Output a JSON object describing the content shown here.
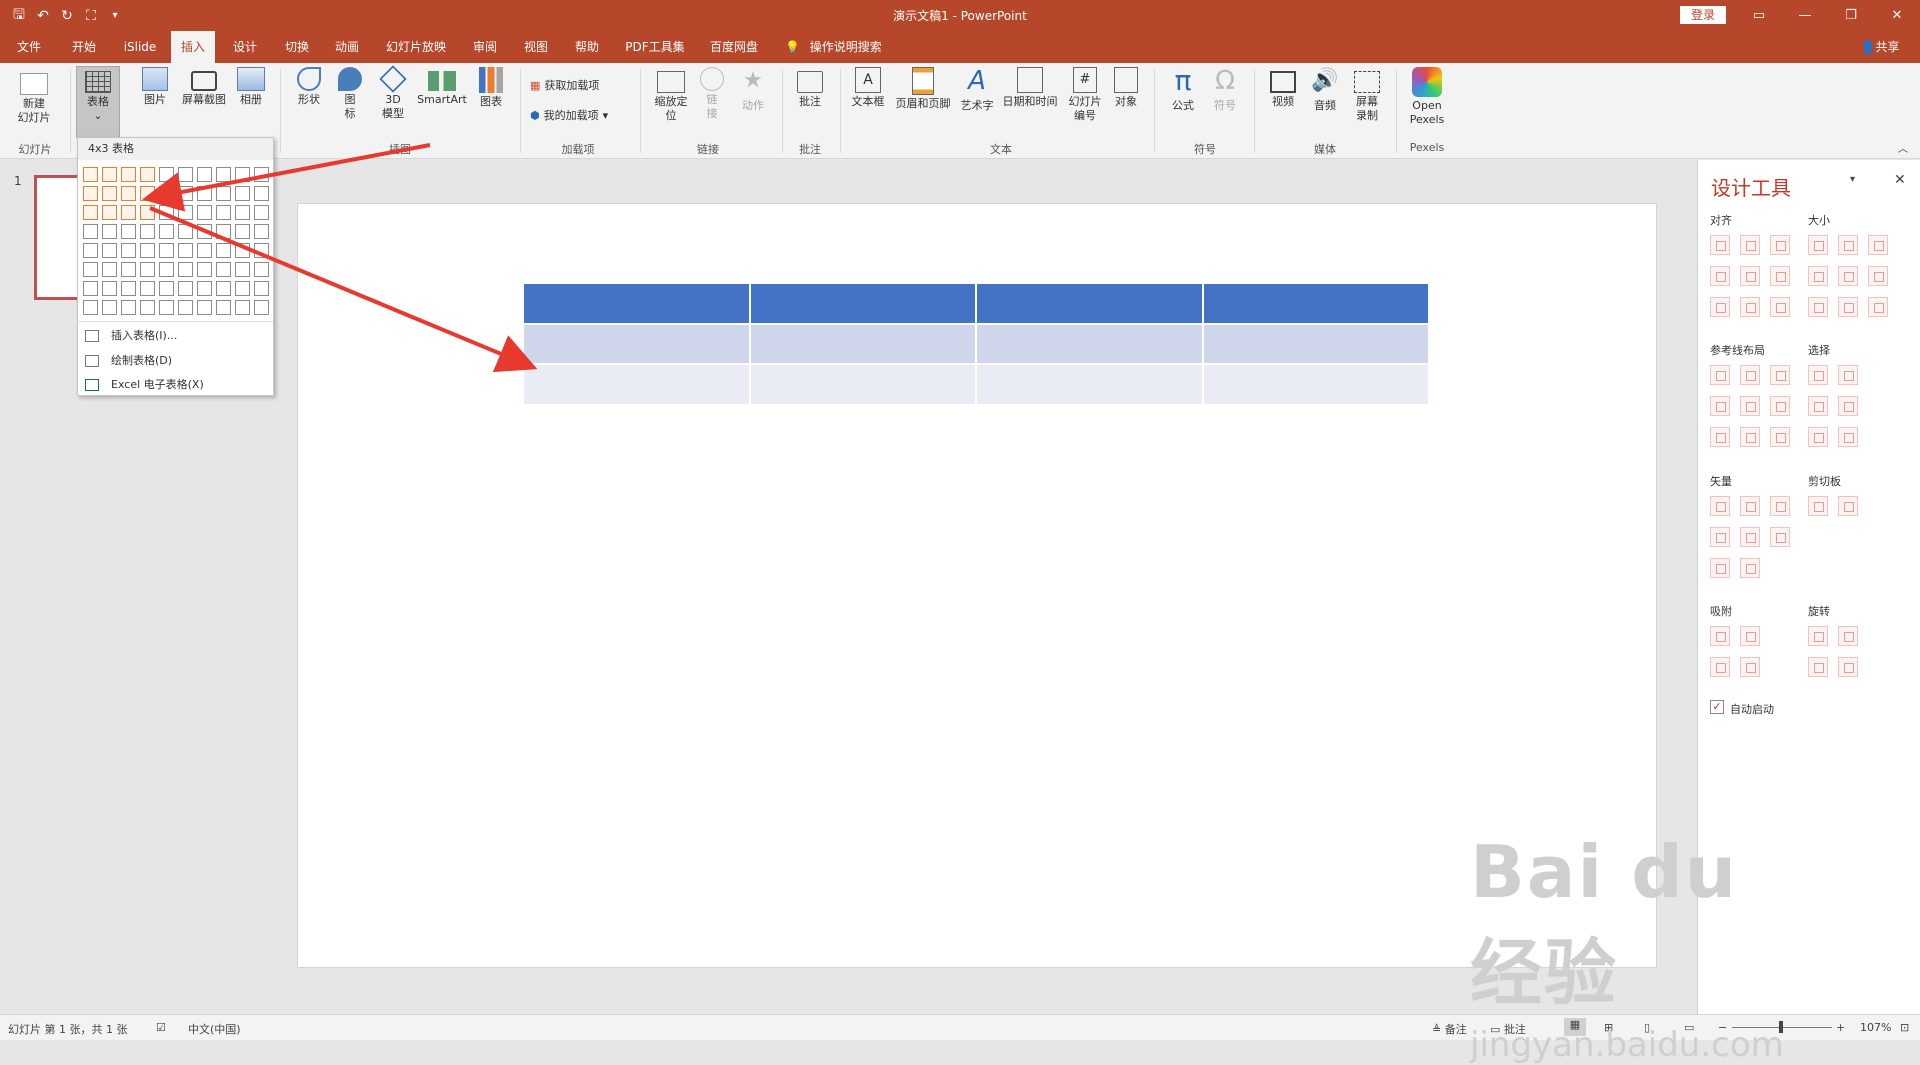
{
  "window": {
    "title": "演示文稿1 - PowerPoint",
    "login_label": "登录",
    "share_label": "共享",
    "search_hint": "操作说明搜索"
  },
  "tabs": [
    "文件",
    "开始",
    "iSlide",
    "插入",
    "设计",
    "切换",
    "动画",
    "幻灯片放映",
    "审阅",
    "视图",
    "帮助",
    "PDF工具集",
    "百度网盘"
  ],
  "active_tab": "插入",
  "ribbon": {
    "buttons": {
      "new_slide": "新建\n幻灯片",
      "table": "表格",
      "picture": "图片",
      "screenshot": "屏幕截图",
      "album": "相册",
      "shapes": "形状",
      "icons": "图\n标",
      "model3d": "3D\n模型",
      "smartart": "SmartArt",
      "chart": "图表",
      "get_addins": "获取加载项",
      "my_addins": "我的加载项",
      "zoom": "缩放定\n位",
      "link": "链\n接",
      "action": "动作",
      "comment": "批注",
      "textbox": "文本框",
      "header_footer": "页眉和页脚",
      "wordart": "艺术字",
      "datetime": "日期和时间",
      "slide_number": "幻灯片\n编号",
      "object": "对象",
      "equation": "公式",
      "symbol": "符号",
      "video": "视频",
      "audio": "音频",
      "screen_record": "屏幕\n录制",
      "pexels": "Open\nPexels"
    },
    "groups": {
      "slides": "幻灯片",
      "illustrations": "插图",
      "addins": "加载项",
      "links": "链接",
      "comments": "批注",
      "text": "文本",
      "symbols": "符号",
      "media": "媒体",
      "pexels": "Pexels"
    }
  },
  "table_dropdown": {
    "header": "4x3 表格",
    "selected_cols": 4,
    "selected_rows": 3,
    "grid_cols": 10,
    "grid_rows": 8,
    "items": [
      "插入表格(I)...",
      "绘制表格(D)",
      "Excel 电子表格(X)"
    ]
  },
  "slide_panel": {
    "slide_number": "1"
  },
  "slide_table": {
    "cols": 4,
    "rows": 3,
    "header_color": "#4472c4",
    "band1_color": "#cfd5ea",
    "band2_color": "#e9ebf5"
  },
  "design_pane": {
    "title": "设计工具",
    "sections": {
      "align": "对齐",
      "size": "大小",
      "guides": "参考线布局",
      "select": "选择",
      "vector": "矢量",
      "clipboard": "剪切板",
      "snap": "吸附",
      "rotate": "旋转"
    },
    "auto_start_label": "自动启动",
    "auto_start_checked": true
  },
  "statusbar": {
    "slide_info": "幻灯片 第 1 张，共 1 张",
    "language": "中文(中国)",
    "notes": "备注",
    "comments": "批注",
    "zoom": "107%"
  },
  "colors": {
    "accent": "#b7472a",
    "arrow": "#e8392f",
    "grid_highlight": "#ed7d31"
  },
  "watermark": {
    "brand": "Bai du 经验",
    "url": "jingyan.baidu.com"
  }
}
